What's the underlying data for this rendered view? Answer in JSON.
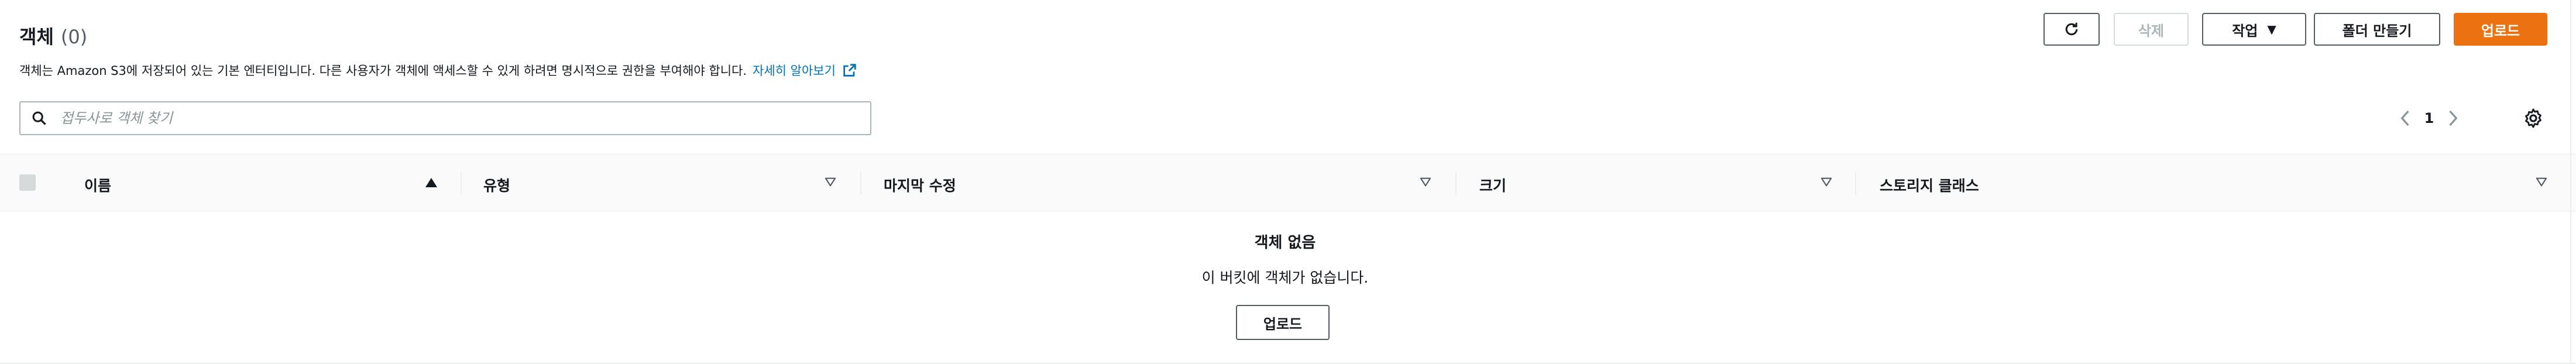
{
  "header": {
    "title": "객체",
    "count": "(0)",
    "description": "객체는 Amazon S3에 저장되어 있는 기본 엔터티입니다. 다른 사용자가 객체에 액세스할 수 있게 하려면 명시적으로 권한을 부여해야 합니다.",
    "learn_more": "자세히 알아보기"
  },
  "toolbar": {
    "delete_label": "삭제",
    "actions_label": "작업",
    "create_folder_label": "폴더 만들기",
    "upload_label": "업로드"
  },
  "search": {
    "placeholder": "접두사로 객체 찾기",
    "value": ""
  },
  "pagination": {
    "current_page": "1"
  },
  "table": {
    "columns": [
      {
        "label": "이름",
        "sort": "ascending"
      },
      {
        "label": "유형",
        "sort": "none"
      },
      {
        "label": "마지막 수정",
        "sort": "none"
      },
      {
        "label": "크기",
        "sort": "none"
      },
      {
        "label": "스토리지 클래스",
        "sort": "none"
      }
    ]
  },
  "empty_state": {
    "title": "객체 없음",
    "description": "이 버킷에 객체가 없습니다.",
    "upload_label": "업로드"
  },
  "icons": {
    "refresh": "refresh-icon",
    "external_link": "external-link-icon",
    "search": "search-icon",
    "prev": "chevron-left-icon",
    "next": "chevron-right-icon",
    "settings": "gear-icon",
    "sort_asc": "sort-ascending-icon",
    "sort_none": "sort-down-outline-icon"
  },
  "colors": {
    "primary": "#ec7211",
    "link": "#0073bb",
    "text": "#16191f",
    "disabled": "#aab7b8"
  }
}
